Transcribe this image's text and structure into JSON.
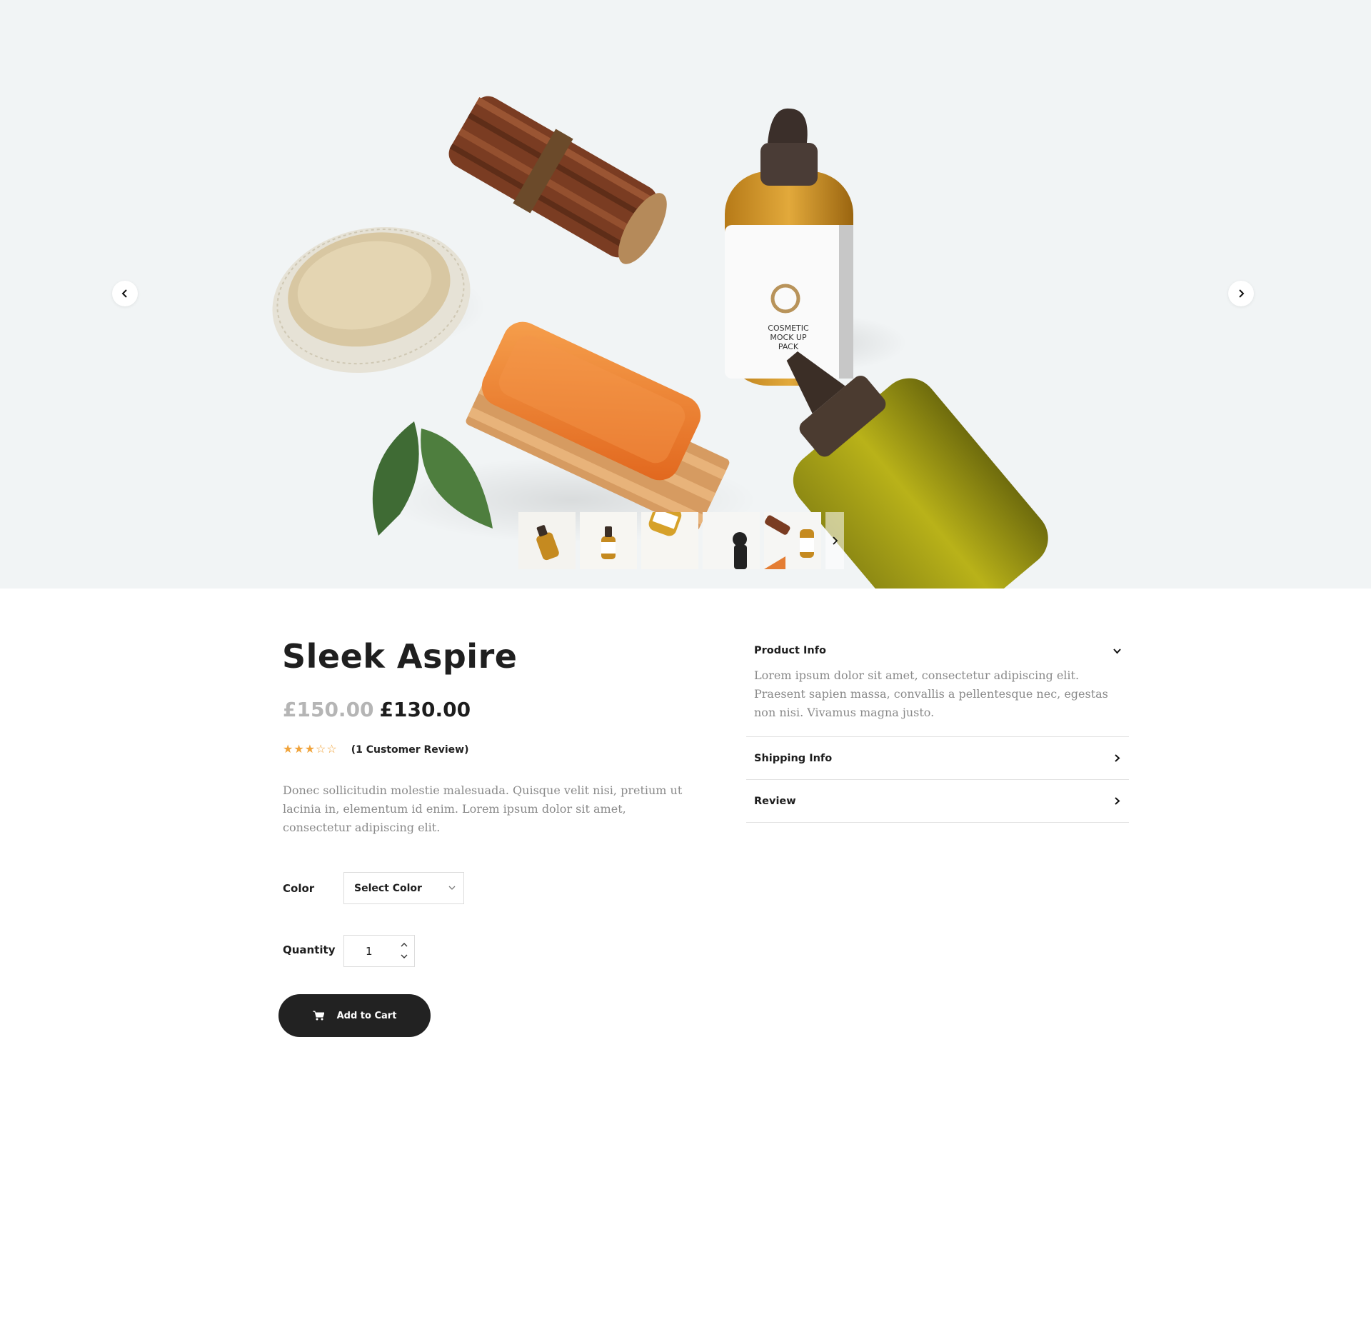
{
  "gallery": {
    "prev_icon": "chevron-left-icon",
    "next_icon": "chevron-right-icon",
    "thumbnails": [
      {
        "name": "thumb-amber-dropper-bottle"
      },
      {
        "name": "thumb-dropper-bottle-white-label"
      },
      {
        "name": "thumb-bottle-closeup"
      },
      {
        "name": "thumb-dark-pump-bottle"
      },
      {
        "name": "thumb-cinnamon-and-bottle"
      }
    ],
    "thumb_next_icon": "chevron-right-icon"
  },
  "product": {
    "title": "Sleek Aspire",
    "price_old": "£150.00",
    "price_new": "£130.00",
    "rating": 3,
    "rating_max": 5,
    "review_count_label": "(1 Customer Review)",
    "description": "Donec sollicitudin molestie malesuada. Quisque velit nisi, pretium ut lacinia in, elementum id enim. Lorem ipsum dolor sit amet, consectetur adipiscing elit."
  },
  "options": {
    "color_label": "Color",
    "color_select_value": "Select Color",
    "quantity_label": "Quantity",
    "quantity_value": "1"
  },
  "cart": {
    "add_label": "Add to Cart",
    "icon": "cart-icon"
  },
  "accordion": [
    {
      "title": "Product Info",
      "expanded": true,
      "body": "Lorem ipsum dolor sit amet, consectetur adipiscing elit. Praesent sapien massa, convallis a pellentesque nec, egestas non nisi. Vivamus magna justo."
    },
    {
      "title": "Shipping Info",
      "expanded": false
    },
    {
      "title": "Review",
      "expanded": false
    }
  ],
  "colors": {
    "hero_bg": "#f1f4f5",
    "star": "#f0a33a",
    "old_price": "#b5b5b5",
    "button_bg": "#222222",
    "body_text": "#8a8a8a"
  }
}
